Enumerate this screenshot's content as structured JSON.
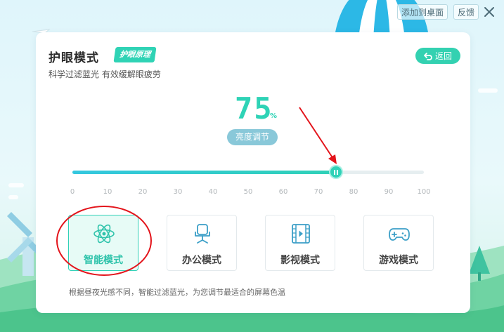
{
  "window": {
    "add_to_desktop": "添加到桌面",
    "feedback": "反馈"
  },
  "panel": {
    "title": "护眼模式",
    "principle_badge": "护眼原理",
    "subtitle": "科学过滤蓝光  有效缓解眼疲劳",
    "back_label": "返回"
  },
  "brightness": {
    "value": "75",
    "unit": "%",
    "label": "亮度调节",
    "level_percent": 75,
    "ticks": [
      "0",
      "10",
      "20",
      "30",
      "40",
      "50",
      "60",
      "70",
      "80",
      "90",
      "100"
    ]
  },
  "modes": [
    {
      "label": "智能模式",
      "icon": "atom-icon",
      "selected": true
    },
    {
      "label": "办公模式",
      "icon": "office-chair-icon",
      "selected": false
    },
    {
      "label": "影视模式",
      "icon": "film-icon",
      "selected": false
    },
    {
      "label": "游戏模式",
      "icon": "gamepad-icon",
      "selected": false
    }
  ],
  "hint": "根据昼夜光感不同，智能过滤蓝光，为您调节最适合的屏幕色温",
  "colors": {
    "accent": "#2fd1b7",
    "annotation_red": "#e3141b",
    "text_dark": "#2b2b2b"
  }
}
